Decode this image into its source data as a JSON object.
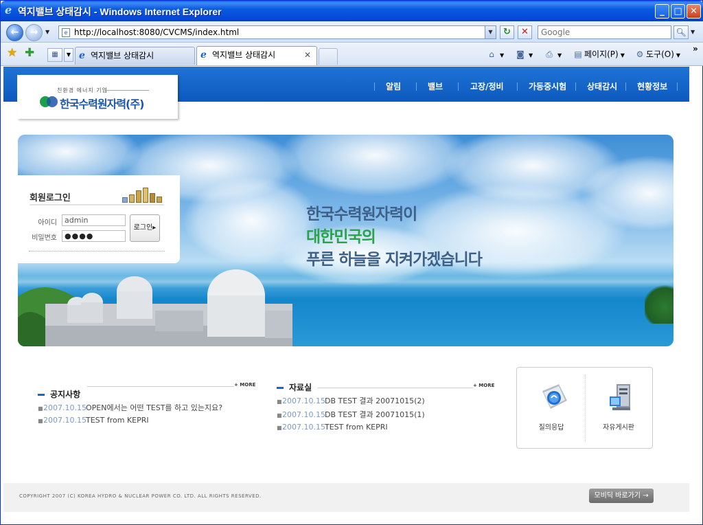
{
  "browser": {
    "window_title": "역지밸브 상태감시 - Windows Internet Explorer",
    "address": "http://localhost:8080/CVCMS/index.html",
    "search_placeholder": "Google",
    "tabs": [
      {
        "label": "역지밸브 상태감시",
        "active": false
      },
      {
        "label": "역지밸브 상태감시",
        "active": true
      }
    ],
    "commands": {
      "page": "페이지(P)",
      "tools": "도구(O)"
    },
    "icons": [
      "back-icon",
      "forward-icon",
      "refresh-icon",
      "stop-icon",
      "search-icon",
      "favorites-star-icon",
      "add-favorites-icon",
      "quick-tabs-icon",
      "home-icon",
      "feed-icon",
      "print-icon",
      "page-icon",
      "tools-gear-icon"
    ]
  },
  "site": {
    "logo_tagline": "친환경 에너지 기업",
    "logo_name": "한국수력원자력(주)",
    "nav": [
      "알림",
      "밸브",
      "고장/정비",
      "가동중시험",
      "상태감시",
      "현황정보"
    ],
    "banner": {
      "line1": "한국수력원자력이",
      "line2": "대한민국의",
      "line3": "푸른 하늘을 지켜가겠습니다"
    },
    "login": {
      "title": "회원로그인",
      "id_label": "아이디",
      "id_value": "admin",
      "pw_label": "비밀번호",
      "pw_value": "●●●●",
      "button": "로그인"
    },
    "notice": {
      "title": "공지사항",
      "more": "+ MORE",
      "items": [
        {
          "date": "2007.10.15",
          "text": "OPEN에서는 어떤 TEST를 하고 있는지요?"
        },
        {
          "date": "2007.10.15",
          "text": "TEST from KEPRI"
        }
      ]
    },
    "data_room": {
      "title": "자료실",
      "more": "+ MORE",
      "items": [
        {
          "date": "2007.10.15",
          "text": "DB TEST 결과 20071015(2)"
        },
        {
          "date": "2007.10.15",
          "text": "DB TEST 결과 20071015(1)"
        },
        {
          "date": "2007.10.15",
          "text": "TEST from KEPRI"
        }
      ]
    },
    "quick_links": [
      {
        "label": "질의응답",
        "icon": "qna-icon"
      },
      {
        "label": "자유게시판",
        "icon": "free-board-icon"
      }
    ],
    "footer": {
      "copyright": "COPYRIGHT 2007 (C) KOREA HYDRO & NUCLEAR POWER CO. LTD. ALL RIGHTS RESERVED.",
      "mobile_button": "모비딕 바로가기"
    }
  },
  "colors": {
    "site_blue": "#1466cc",
    "title_bar": "#0b5be0",
    "date_text": "#7a9bc6",
    "slogan_green": "#2aa24a"
  }
}
